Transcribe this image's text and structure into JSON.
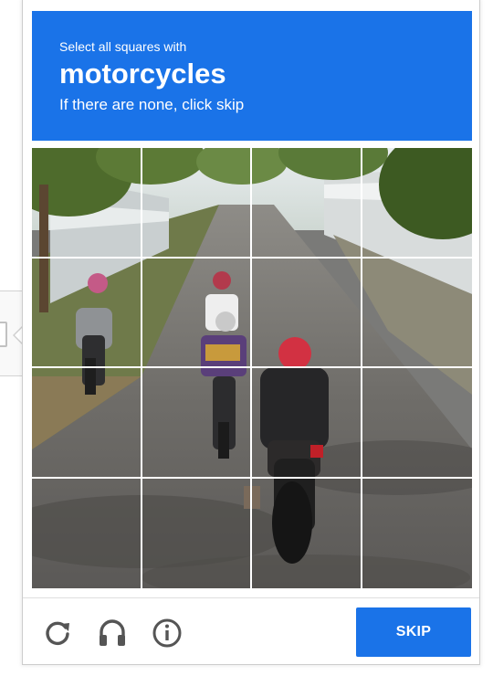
{
  "challenge": {
    "instruction": "Select all squares with",
    "keyword": "motorcycles",
    "subtext": "If there are none, click skip"
  },
  "grid": {
    "rows": 4,
    "columns": 4,
    "tiles_selected": []
  },
  "footer": {
    "reload_icon": "reload-icon",
    "audio_icon": "headphones-icon",
    "info_icon": "info-icon",
    "skip_label": "SKIP"
  },
  "colors": {
    "accent": "#1a73e8",
    "icon_gray": "#555555"
  }
}
